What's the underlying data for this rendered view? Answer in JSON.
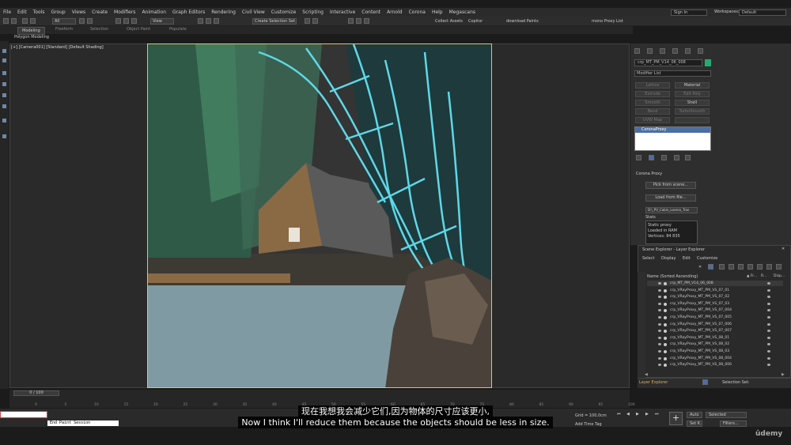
{
  "menu": [
    "File",
    "Edit",
    "Tools",
    "Group",
    "Views",
    "Create",
    "Modifiers",
    "Animation",
    "Graph Editors",
    "Rendering",
    "Civil View",
    "Customize",
    "Scripting",
    "Interactive",
    "Content",
    "Arnold",
    "Corona",
    "Help",
    "Megascans"
  ],
  "signin": "Sign In",
  "workspaces_label": "Workspaces:",
  "workspaces_value": "Default",
  "toolbar": {
    "filter": "All",
    "view": "View",
    "selection_set": "Create Selection Set",
    "collect_assets": "Collect Assets",
    "copitor": "Copitor",
    "download_paints": "download Paints",
    "proxy_list": "mono Proxy List"
  },
  "ribbon_tabs": [
    "Modeling",
    "Freeform",
    "Selection",
    "Object Paint",
    "Populate"
  ],
  "ribbon_sub": "Polygon Modeling",
  "viewport_label": "[+] [Camera001] [Standard] [Default Shading]",
  "command_panel": {
    "object_name": "crp_MT_PM_V14_06_008",
    "object_color": "#1fae72",
    "modifier_list": "Modifier List",
    "buttons": [
      "Lattice",
      "Material",
      "Extrude",
      "Edit Poly",
      "Smooth",
      "Shell",
      "Bend",
      "TurboSmooth",
      "UVW Map",
      ""
    ],
    "stack_item": "CoronaProxy",
    "rollout_title": "Corona Proxy",
    "pick_button": "Pick from scene...",
    "load_button": "Load from file...",
    "path": "D:\\_PV_Cabin_Lorena_Tran",
    "stats_label": "Stats",
    "stats_lines": [
      "Static proxy",
      "",
      "Loaded in RAM",
      "Vertices: 84 835"
    ]
  },
  "scene_explorer": {
    "title": "Scene Explorer - Layer Explorer",
    "menu": [
      "Select",
      "Display",
      "Edit",
      "Customize"
    ],
    "header": "Name (Sorted Ascending)",
    "col_headers": [
      "▲ Fr...",
      "R...",
      "Disp..."
    ],
    "rows": [
      "crp_MT_PM_V14_06_008",
      "crp_VRayProxy_MT_PM_VS_07_01",
      "crp_VRayProxy_MT_PM_VS_07_02",
      "crp_VRayProxy_MT_PM_VS_07_03",
      "crp_VRayProxy_MT_PM_VS_07_004",
      "crp_VRayProxy_MT_PM_VS_07_005",
      "crp_VRayProxy_MT_PM_VS_07_006",
      "crp_VRayProxy_MT_PM_VS_07_007",
      "crp_VRayProxy_MT_PM_VS_08_01",
      "crp_VRayProxy_MT_PM_VS_08_02",
      "crp_VRayProxy_MT_PM_VS_08_03",
      "crp_VRayProxy_MT_PM_VS_08_004",
      "crp_VRayProxy_MT_PM_VS_08_006"
    ],
    "footer_left": "Layer Explorer",
    "footer_right": "Selection Set:"
  },
  "timeline": {
    "slider": "0 / 100",
    "ticks": [
      "0",
      "5",
      "10",
      "15",
      "20",
      "25",
      "30",
      "35",
      "40",
      "45",
      "50",
      "55",
      "60",
      "65",
      "70",
      "75",
      "80",
      "85",
      "90",
      "95",
      "100"
    ]
  },
  "status": {
    "maxscript": "End Paint Session",
    "grid": "Grid = 100,0cm",
    "add_time_tag": "Add Time Tag",
    "auto": "Auto",
    "selected": "Selected",
    "set_k": "Set K.",
    "filters": "Filters..."
  },
  "subtitle_cn": "现在我想我会减少它们,因为物体的尺寸应该更小,",
  "subtitle_en": "Now I think I'll reduce them because the objects should be less in size.",
  "watermark": "ûdemy"
}
